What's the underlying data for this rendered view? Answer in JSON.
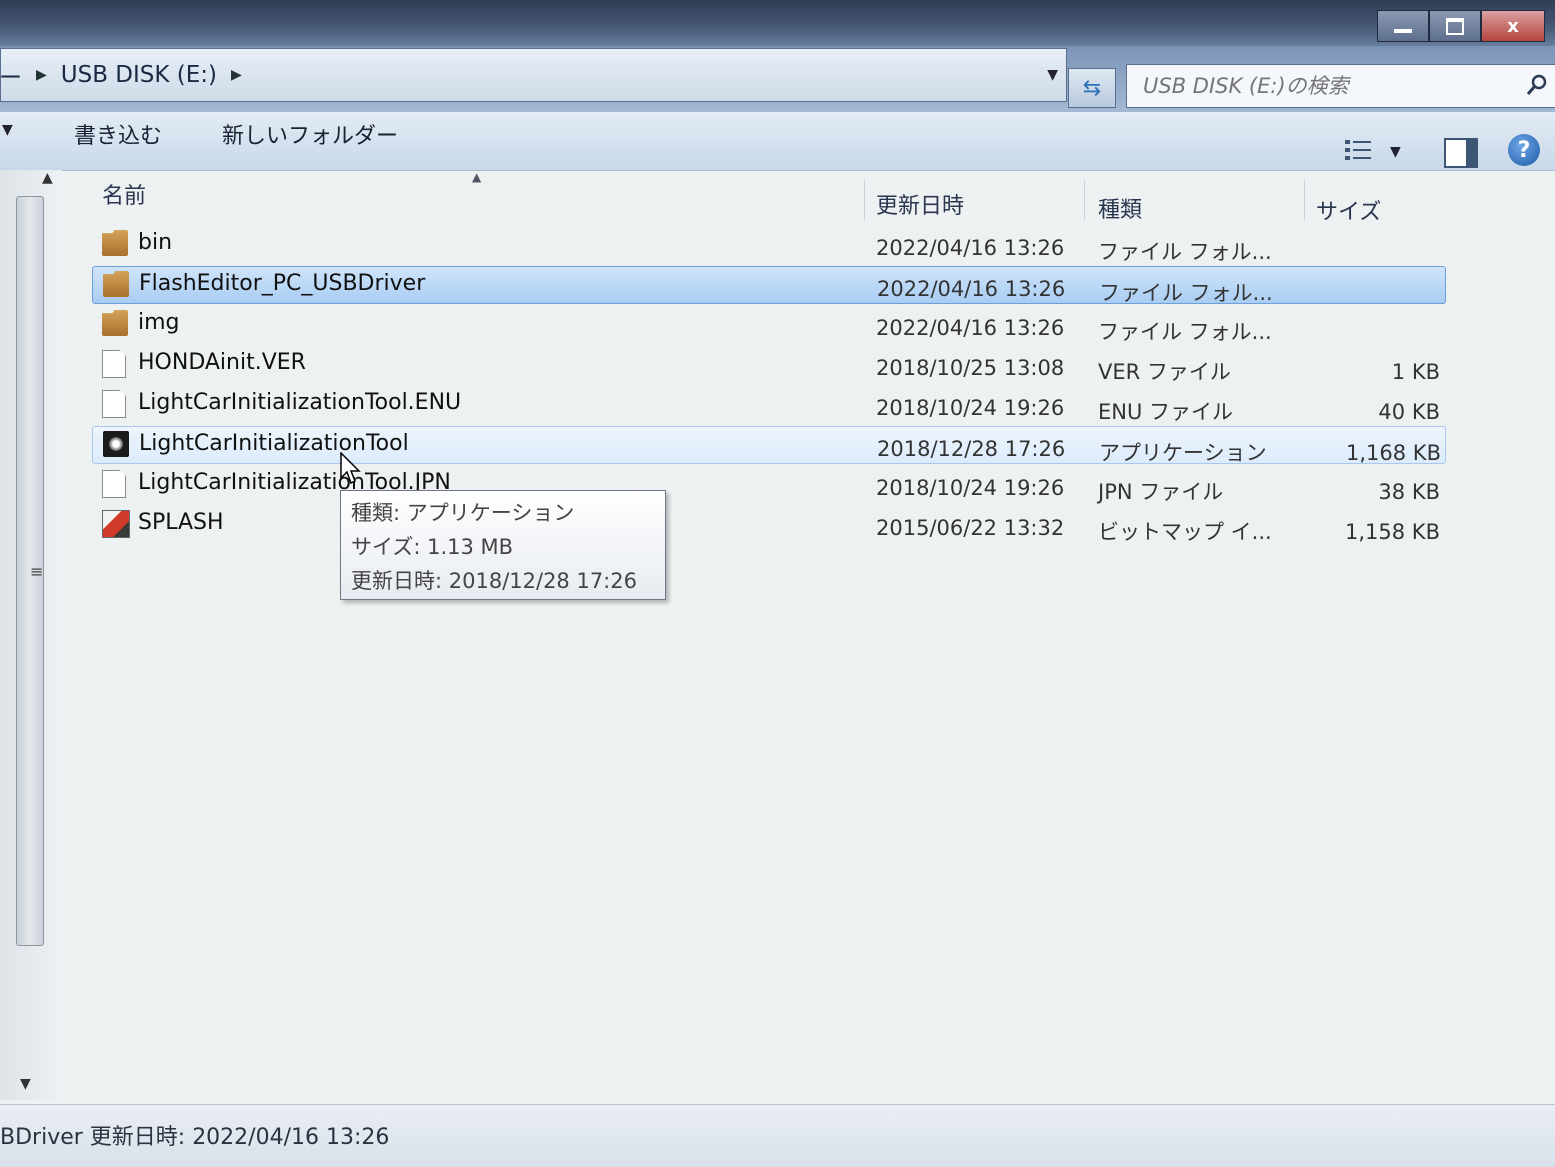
{
  "window": {
    "controls": {
      "minimize": "",
      "maximize": "",
      "close": "x"
    }
  },
  "address": {
    "crumb_prefix": "ー",
    "current": "USB DISK (E:)"
  },
  "search": {
    "placeholder": "USB DISK (E:)の検索"
  },
  "toolbar": {
    "write_label": "書き込む",
    "new_folder_label": "新しいフォルダー"
  },
  "columns": {
    "name": "名前",
    "date": "更新日時",
    "type": "種類",
    "size": "サイズ"
  },
  "files": [
    {
      "name": "bin",
      "date": "2022/04/16 13:26",
      "type": "ファイル フォル...",
      "size": "",
      "icon": "folder-icon"
    },
    {
      "name": "FlashEditor_PC_USBDriver",
      "date": "2022/04/16 13:26",
      "type": "ファイル フォル...",
      "size": "",
      "icon": "folder-icon"
    },
    {
      "name": "img",
      "date": "2022/04/16 13:26",
      "type": "ファイル フォル...",
      "size": "",
      "icon": "folder-icon"
    },
    {
      "name": "HONDAinit.VER",
      "date": "2018/10/25 13:08",
      "type": "VER ファイル",
      "size": "1 KB",
      "icon": "file-icon"
    },
    {
      "name": "LightCarInitializationTool.ENU",
      "date": "2018/10/24 19:26",
      "type": "ENU ファイル",
      "size": "40 KB",
      "icon": "file-icon"
    },
    {
      "name": "LightCarInitializationTool",
      "date": "2018/12/28 17:26",
      "type": "アプリケーション",
      "size": "1,168 KB",
      "icon": "application-icon"
    },
    {
      "name": "LightCarInitializationTool.JPN",
      "date": "2018/10/24 19:26",
      "type": "JPN ファイル",
      "size": "38 KB",
      "icon": "file-icon"
    },
    {
      "name": "SPLASH",
      "date": "2015/06/22 13:32",
      "type": "ビットマップ イ...",
      "size": "1,158 KB",
      "icon": "bitmap-icon"
    }
  ],
  "tooltip": {
    "line1": "種類: アプリケーション",
    "line2": "サイズ: 1.13 MB",
    "line3": "更新日時: 2018/12/28 17:26"
  },
  "status": {
    "text": "BDriver 更新日時: 2022/04/16 13:26"
  }
}
